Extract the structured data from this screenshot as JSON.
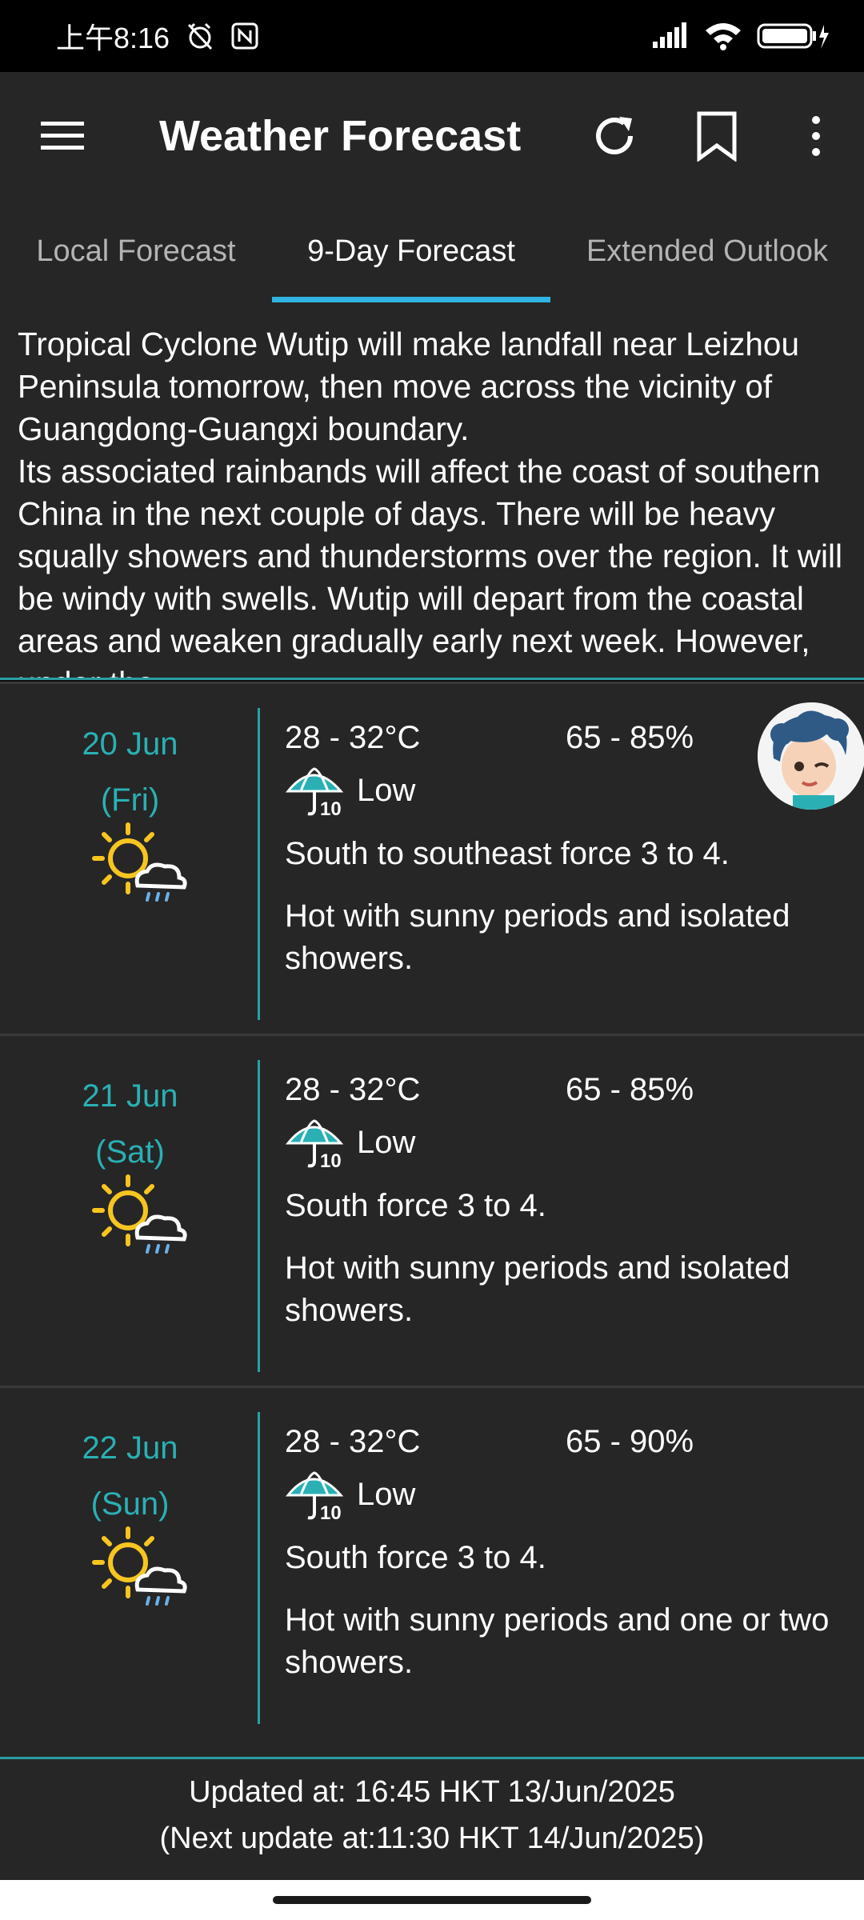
{
  "status_bar": {
    "time": "上午8:16",
    "battery_icon": "battery-charging-icon"
  },
  "app_bar": {
    "title": "Weather Forecast"
  },
  "tabs": [
    {
      "label": "Local Forecast",
      "active": false
    },
    {
      "label": "9-Day Forecast",
      "active": true
    },
    {
      "label": "Extended Outlook",
      "active": false
    }
  ],
  "summary": {
    "text": "Tropical Cyclone Wutip will make landfall near Leizhou Peninsula tomorrow, then move across the vicinity of Guangdong-Guangxi boundary.\nIts associated rainbands will affect the coast of southern China in the next couple of days. There will be heavy squally showers and thunderstorms over the region. It will be windy with swells. Wutip will depart from the coastal areas and weaken gradually early next week. However, under the"
  },
  "forecasts": [
    {
      "date": "20 Jun",
      "day": "(Fri)",
      "temp": "28 - 32°C",
      "humidity": "65 - 85%",
      "psr": "Low",
      "wind": "South to southeast force 3 to 4.",
      "desc": "Hot with sunny periods and isolated showers."
    },
    {
      "date": "21 Jun",
      "day": "(Sat)",
      "temp": "28 - 32°C",
      "humidity": "65 - 85%",
      "psr": "Low",
      "wind": "South force 3 to 4.",
      "desc": "Hot with sunny periods and isolated showers."
    },
    {
      "date": "22 Jun",
      "day": "(Sun)",
      "temp": "28 - 32°C",
      "humidity": "65 - 90%",
      "psr": "Low",
      "wind": "South force 3 to 4.",
      "desc": "Hot with sunny periods and one or two showers."
    }
  ],
  "footer": {
    "updated": "Updated at: 16:45 HKT 13/Jun/2025",
    "next_update": "(Next update at:11:30 HKT 14/Jun/2025)"
  },
  "colors": {
    "accent": "#2ab0b4",
    "tab_indicator": "#2fb4e4",
    "background": "#262626"
  }
}
